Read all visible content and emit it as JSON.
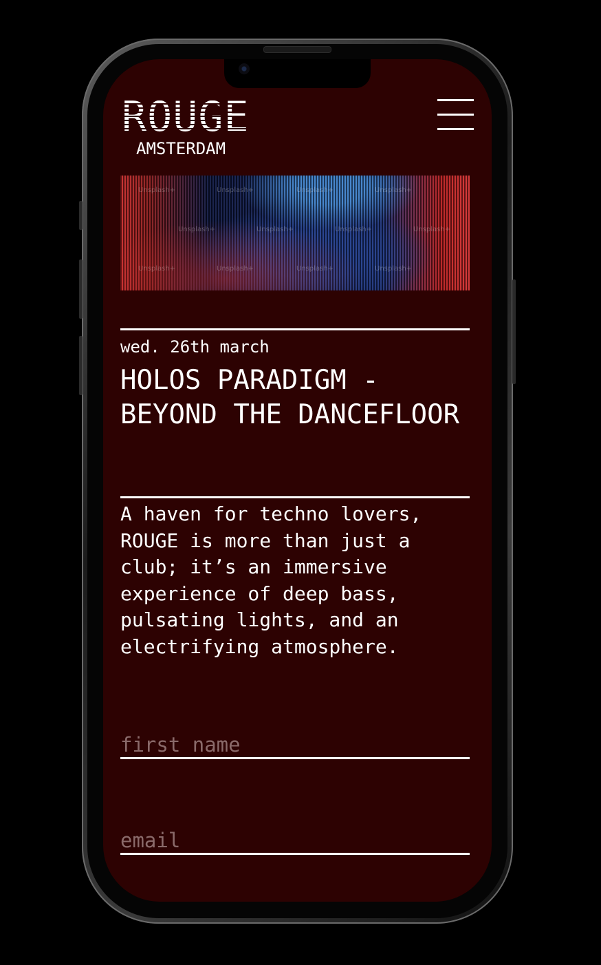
{
  "brand": {
    "name": "ROUGE",
    "city": "AMSTERDAM"
  },
  "menu": {
    "icon": "hamburger-menu-icon"
  },
  "hero": {
    "watermarks": [
      "Unsplash+",
      "Unsplash+",
      "Unsplash+",
      "Unsplash+",
      "Unsplash+",
      "Unsplash+",
      "Unsplash+",
      "Unsplash+",
      "Unsplash+",
      "Unsplash+",
      "Unsplash+",
      "Unsplash+"
    ]
  },
  "event": {
    "date": "wed. 26th march",
    "title": "HOLOS PARADIGM - BEYOND THE DANCEFLOOR",
    "description": "A haven for techno lovers, ROUGE is more than just a club; it’s an immersive experience of deep bass, pulsating lights, and an electrifying atmosphere."
  },
  "form": {
    "first_name_placeholder": "first name",
    "email_placeholder": "email"
  },
  "colors": {
    "background": "#2d0202",
    "text": "#ffffff",
    "placeholder": "#8a6a6a"
  }
}
